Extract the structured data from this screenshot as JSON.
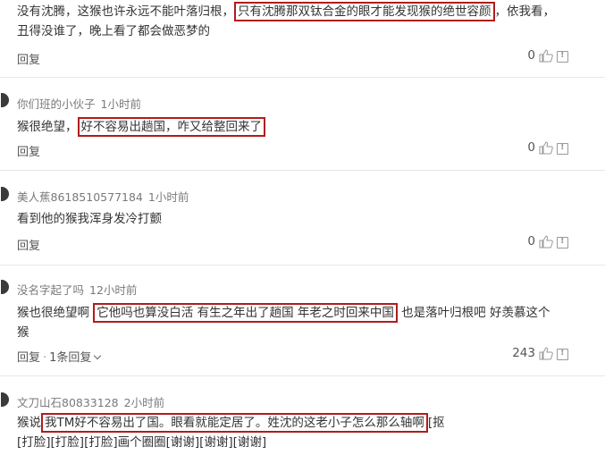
{
  "comments": [
    {
      "lines": [
        {
          "pre": "没有沈腾，这猴也许永远不能叶落归根，",
          "hl": "只有沈腾那双钛合金的眼才能发现猴的绝世容颜",
          "post": "，依我看，"
        },
        {
          "pre": "丑得没谁了，晚上看了都会做恶梦的"
        }
      ],
      "reply_label": "回复",
      "likes": "0"
    },
    {
      "author": "你们班的小伙子",
      "time": "1小时前",
      "lines": [
        {
          "pre": "猴很绝望，",
          "hl": "好不容易出趟国，咋又给整回来了"
        }
      ],
      "reply_label": "回复",
      "likes": "0"
    },
    {
      "author": "美人蕉8618510577184",
      "time": "1小时前",
      "lines": [
        {
          "pre": "看到他的猴我浑身发冷打颤"
        }
      ],
      "reply_label": "回复",
      "likes": "0"
    },
    {
      "author": "没名字起了吗",
      "time": "12小时前",
      "lines": [
        {
          "pre": "猴也很绝望啊 ",
          "hl": "它他吗也算没白活 有生之年出了趟国 年老之时回来中国",
          "post": " 也是落叶归根吧 好羡慕这个"
        },
        {
          "pre": "猴"
        }
      ],
      "reply_label": "回复",
      "reply_count": "1条回复",
      "likes": "243"
    },
    {
      "author": "文刀山石80833128",
      "time": "2小时前",
      "lines": [
        {
          "pre": "猴说",
          "hl": "我TM好不容易出了国。眼看就能定居了。姓沈的这老小子怎么那么轴啊",
          "post": "[抠"
        },
        {
          "pre": "[打脸][打脸][打脸]画个圈圈[谢谢][谢谢][谢谢]"
        }
      ]
    }
  ]
}
